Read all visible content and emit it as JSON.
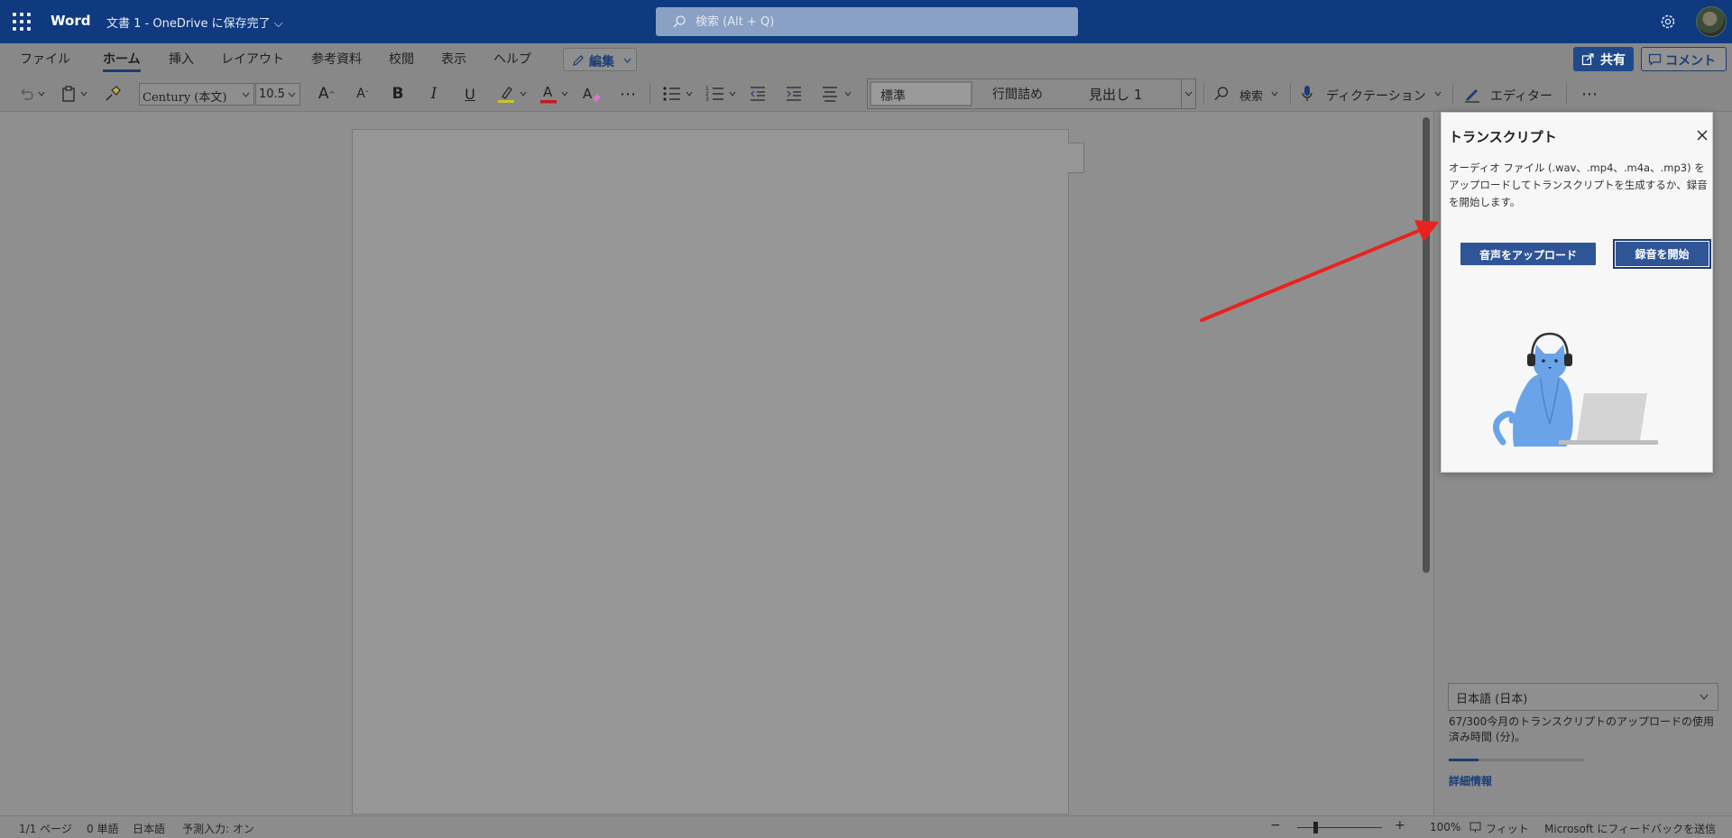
{
  "titlebar": {
    "app_name": "Word",
    "doc_title": "文書 1 - OneDrive に保存完了 ⌵",
    "search_placeholder": "検索 (Alt + Q)"
  },
  "menu": {
    "items": [
      "ファイル",
      "ホーム",
      "挿入",
      "レイアウト",
      "参考資料",
      "校閲",
      "表示",
      "ヘルプ"
    ],
    "active": "ホーム",
    "edit_label": "編集",
    "share_label": "共有",
    "comment_label": "コメント"
  },
  "toolbar": {
    "font_name": "Century (本文)",
    "font_size": "10.5",
    "styles": [
      "標準",
      "行間詰め",
      "見出し 1"
    ],
    "search_label": "検索",
    "dictation_label": "ディクテーション",
    "editor_label": "エディター"
  },
  "transcript_popup": {
    "title": "トランスクリプト",
    "description": "オーディオ ファイル (.wav、.mp4、.m4a、.mp3) をアップロードしてトランスクリプトを生成するか、録音を開始します。",
    "upload_button": "音声をアップロード",
    "record_button": "録音を開始"
  },
  "right_pane": {
    "language": "日本語 (日本)",
    "usage_text": "67/300今月のトランスクリプトのアップロードの使用済み時間 (分)。",
    "usage_fraction": 0.223,
    "details_link": "詳細情報"
  },
  "statusbar": {
    "page": "1/1 ページ",
    "words": "0 単語",
    "language": "日本語",
    "predictive": "予測入力: オン",
    "zoom": "100%",
    "fit": "フィット",
    "feedback": "Microsoft にフィードバックを送信"
  },
  "colors": {
    "titlebar": "#0f3a80",
    "accent": "#2f5597",
    "arrow": "#e8231f"
  }
}
